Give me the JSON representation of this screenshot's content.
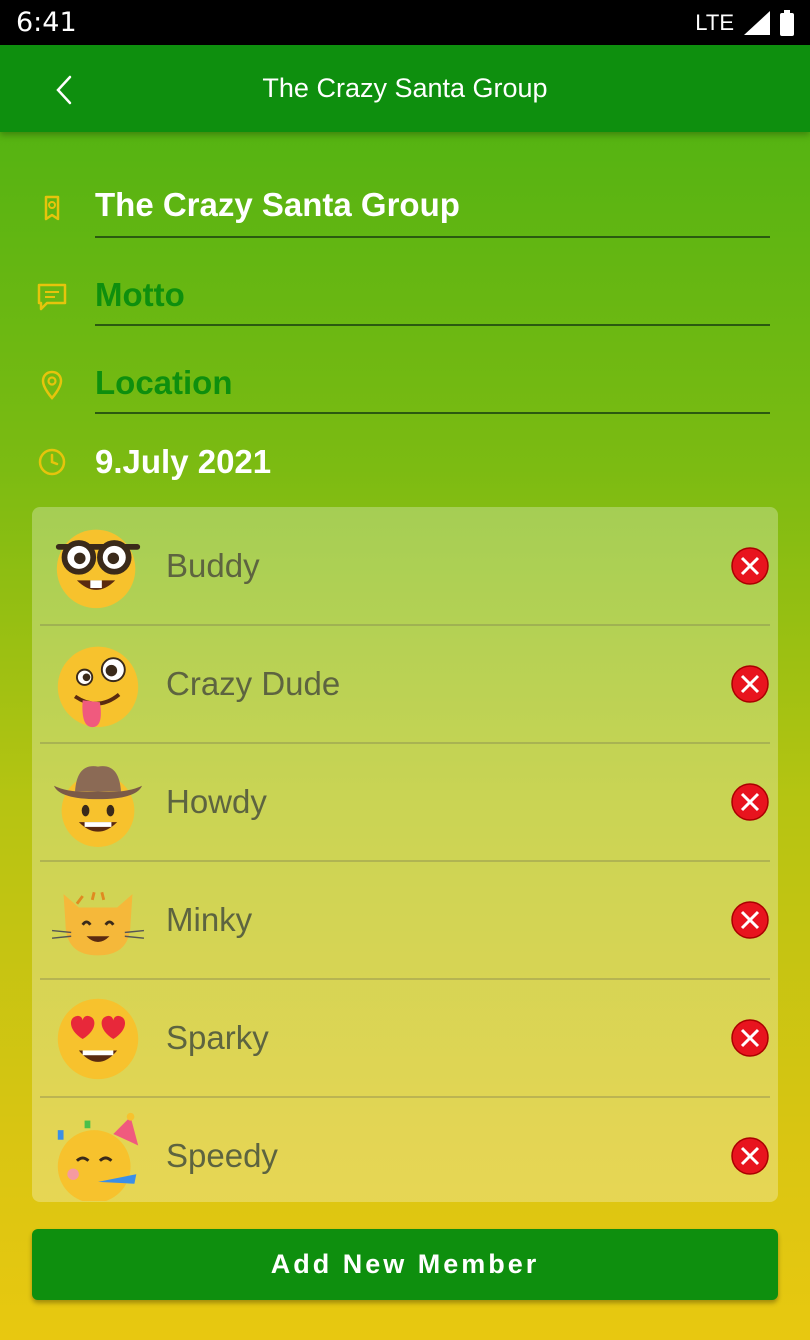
{
  "status": {
    "time": "6:41",
    "network": "LTE"
  },
  "header": {
    "title": "The Crazy Santa Group"
  },
  "form": {
    "group_name": "The Crazy Santa Group",
    "motto_placeholder": "Motto",
    "location_placeholder": "Location",
    "date": "9.July 2021"
  },
  "members": [
    {
      "name": "Buddy",
      "emoji": "nerd-face-emoji"
    },
    {
      "name": "Crazy Dude",
      "emoji": "zany-face-emoji"
    },
    {
      "name": "Howdy",
      "emoji": "cowboy-face-emoji"
    },
    {
      "name": "Minky",
      "emoji": "cat-face-emoji"
    },
    {
      "name": "Sparky",
      "emoji": "heart-eyes-emoji"
    },
    {
      "name": "Speedy",
      "emoji": "party-face-emoji"
    }
  ],
  "add_button": "Add New Member",
  "colors": {
    "primary": "#0e8f0e",
    "accent": "#d8c40a",
    "delete": "#e8141e"
  }
}
